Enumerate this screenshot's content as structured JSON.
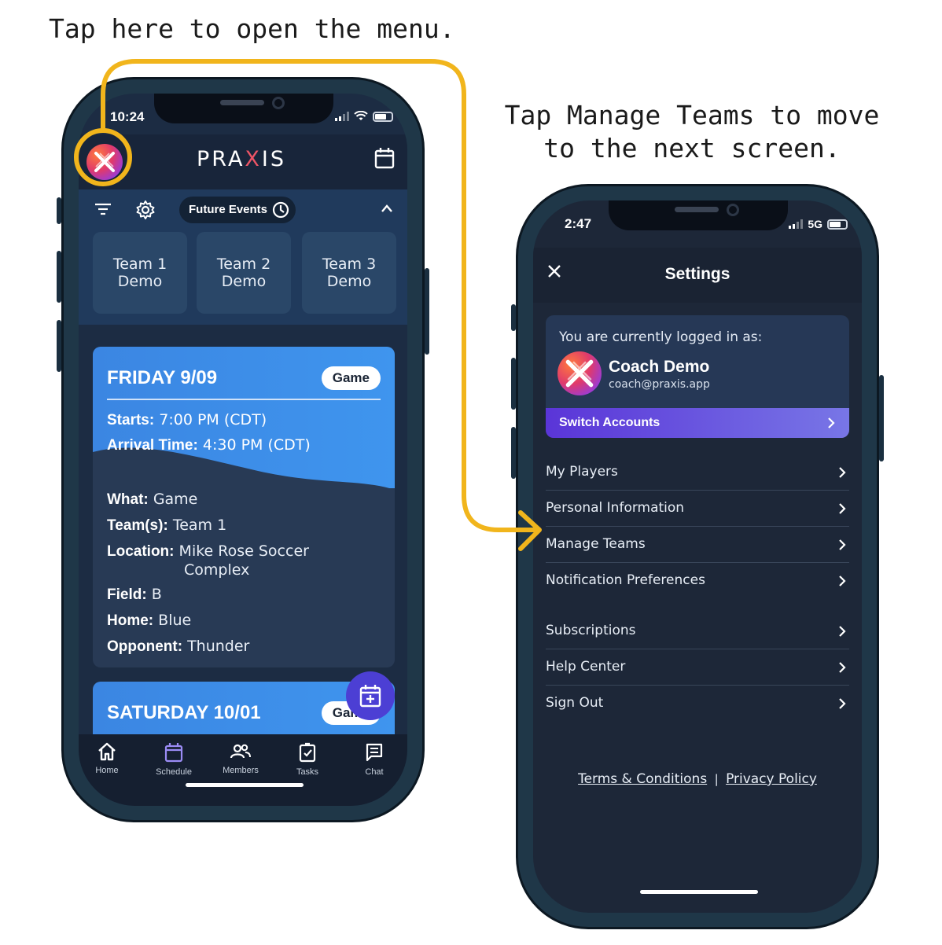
{
  "captions": {
    "left": "Tap here to open the menu.",
    "right": "Tap Manage Teams to move to the next screen."
  },
  "phone1": {
    "status_time": "10:24",
    "brand_prefix": "PRA",
    "brand_x": "X",
    "brand_suffix": "IS",
    "filter_pill": "Future Events",
    "teams": [
      {
        "line1": "Team 1",
        "line2": "Demo"
      },
      {
        "line1": "Team 2",
        "line2": "Demo"
      },
      {
        "line1": "Team 3",
        "line2": "Demo"
      }
    ],
    "event1": {
      "day": "FRIDAY 9/09",
      "badge": "Game",
      "starts_label": "Starts:",
      "starts_value": "7:00 PM (CDT)",
      "arrival_label": "Arrival Time:",
      "arrival_value": "4:30 PM (CDT)",
      "what_label": "What:",
      "what_value": "Game",
      "teams_label": "Team(s):",
      "teams_value": "Team 1",
      "location_label": "Location:",
      "location_value_1": "Mike Rose Soccer",
      "location_value_2": "Complex",
      "field_label": "Field:",
      "field_value": "B",
      "home_label": "Home:",
      "home_value": "Blue",
      "opponent_label": "Opponent:",
      "opponent_value": "Thunder"
    },
    "event2": {
      "day": "SATURDAY 10/01",
      "badge": "Game"
    },
    "tabs": [
      {
        "label": "Home",
        "icon": "home-icon"
      },
      {
        "label": "Schedule",
        "icon": "calendar-icon"
      },
      {
        "label": "Members",
        "icon": "members-icon"
      },
      {
        "label": "Tasks",
        "icon": "tasks-icon"
      },
      {
        "label": "Chat",
        "icon": "chat-icon"
      }
    ]
  },
  "phone2": {
    "status_time": "2:47",
    "network": "5G",
    "title": "Settings",
    "account": {
      "label": "You are currently logged in as:",
      "name": "Coach Demo",
      "email": "coach@praxis.app",
      "switch": "Switch Accounts"
    },
    "menu_group1": [
      "My Players",
      "Personal Information",
      "Manage Teams",
      "Notification Preferences"
    ],
    "menu_group2": [
      "Subscriptions",
      "Help Center",
      "Sign Out"
    ],
    "footer": {
      "terms": "Terms & Conditions",
      "separator": "|",
      "privacy": "Privacy Policy"
    }
  },
  "colors": {
    "annotation": "#f1b51c",
    "accent_blue": "#3b86e2",
    "accent_purple": "#5a35d8",
    "screen_bg": "#1c2c43"
  }
}
